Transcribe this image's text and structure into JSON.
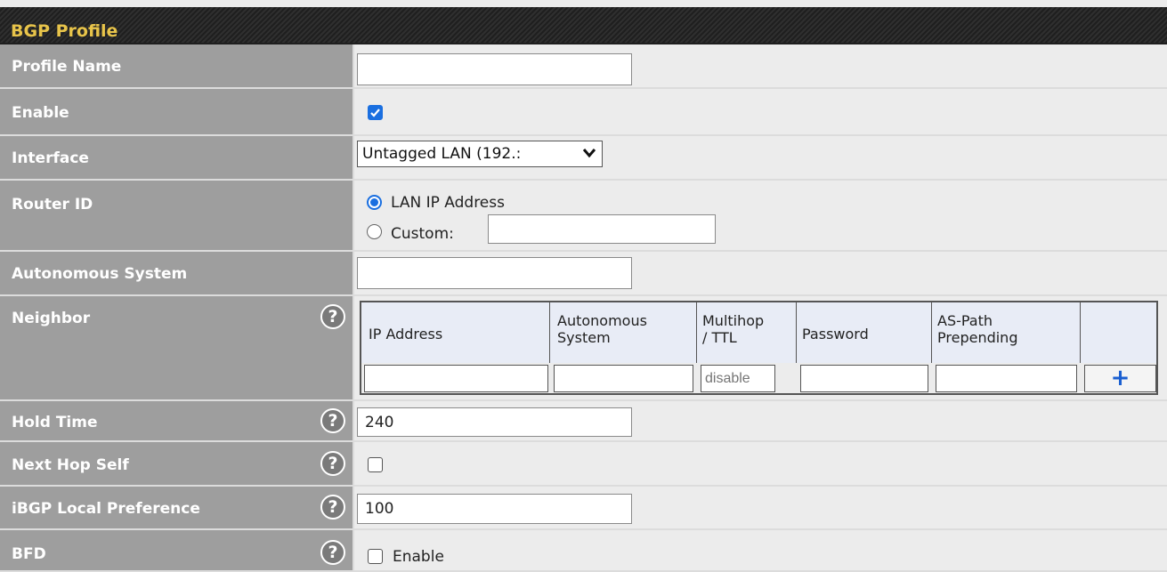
{
  "panel": {
    "title": "BGP Profile"
  },
  "fields": {
    "profile_name": {
      "label": "Profile Name",
      "value": ""
    },
    "enable": {
      "label": "Enable",
      "checked": true
    },
    "interface": {
      "label": "Interface",
      "selected": "Untagged LAN (192.:"
    },
    "router_id": {
      "label": "Router ID",
      "options": [
        {
          "label": "LAN IP Address",
          "selected": true
        },
        {
          "label": "Custom:",
          "selected": false,
          "value": ""
        }
      ]
    },
    "autonomous_system": {
      "label": "Autonomous System",
      "value": ""
    },
    "neighbor": {
      "label": "Neighbor",
      "columns": [
        "IP Address",
        "Autonomous\nSystem",
        "Multihop\n/ TTL",
        "Password",
        "AS-Path\nPrepending",
        ""
      ],
      "multihop_placeholder": "disable",
      "add_label": "+"
    },
    "hold_time": {
      "label": "Hold Time",
      "value": "240"
    },
    "next_hop_self": {
      "label": "Next Hop Self",
      "checked": false
    },
    "ibgp_local_preference": {
      "label": "iBGP Local Preference",
      "value": "100"
    },
    "bfd": {
      "label": "BFD",
      "option_label": "Enable",
      "checked": false
    }
  },
  "icons": {
    "help": "help-icon",
    "help_glyph": "?"
  },
  "colors": {
    "label_bg": "#9e9e9e",
    "title_text": "#e8c44a",
    "accent": "#1a6fe0"
  }
}
